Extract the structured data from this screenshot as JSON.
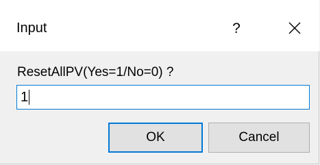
{
  "window": {
    "title": "Input",
    "help_glyph": "?",
    "help_icon": "question-mark-icon",
    "close_icon": "close-icon"
  },
  "prompt": {
    "text": "ResetAllPV(Yes=1/No=0) ?"
  },
  "input": {
    "value": "1",
    "focused": true
  },
  "buttons": {
    "ok_label": "OK",
    "cancel_label": "Cancel"
  },
  "colors": {
    "accent": "#0078d7",
    "dialog_bg": "#f0f0f0",
    "titlebar_bg": "#ffffff",
    "button_bg": "#e1e1e1",
    "button_border": "#adadad"
  }
}
